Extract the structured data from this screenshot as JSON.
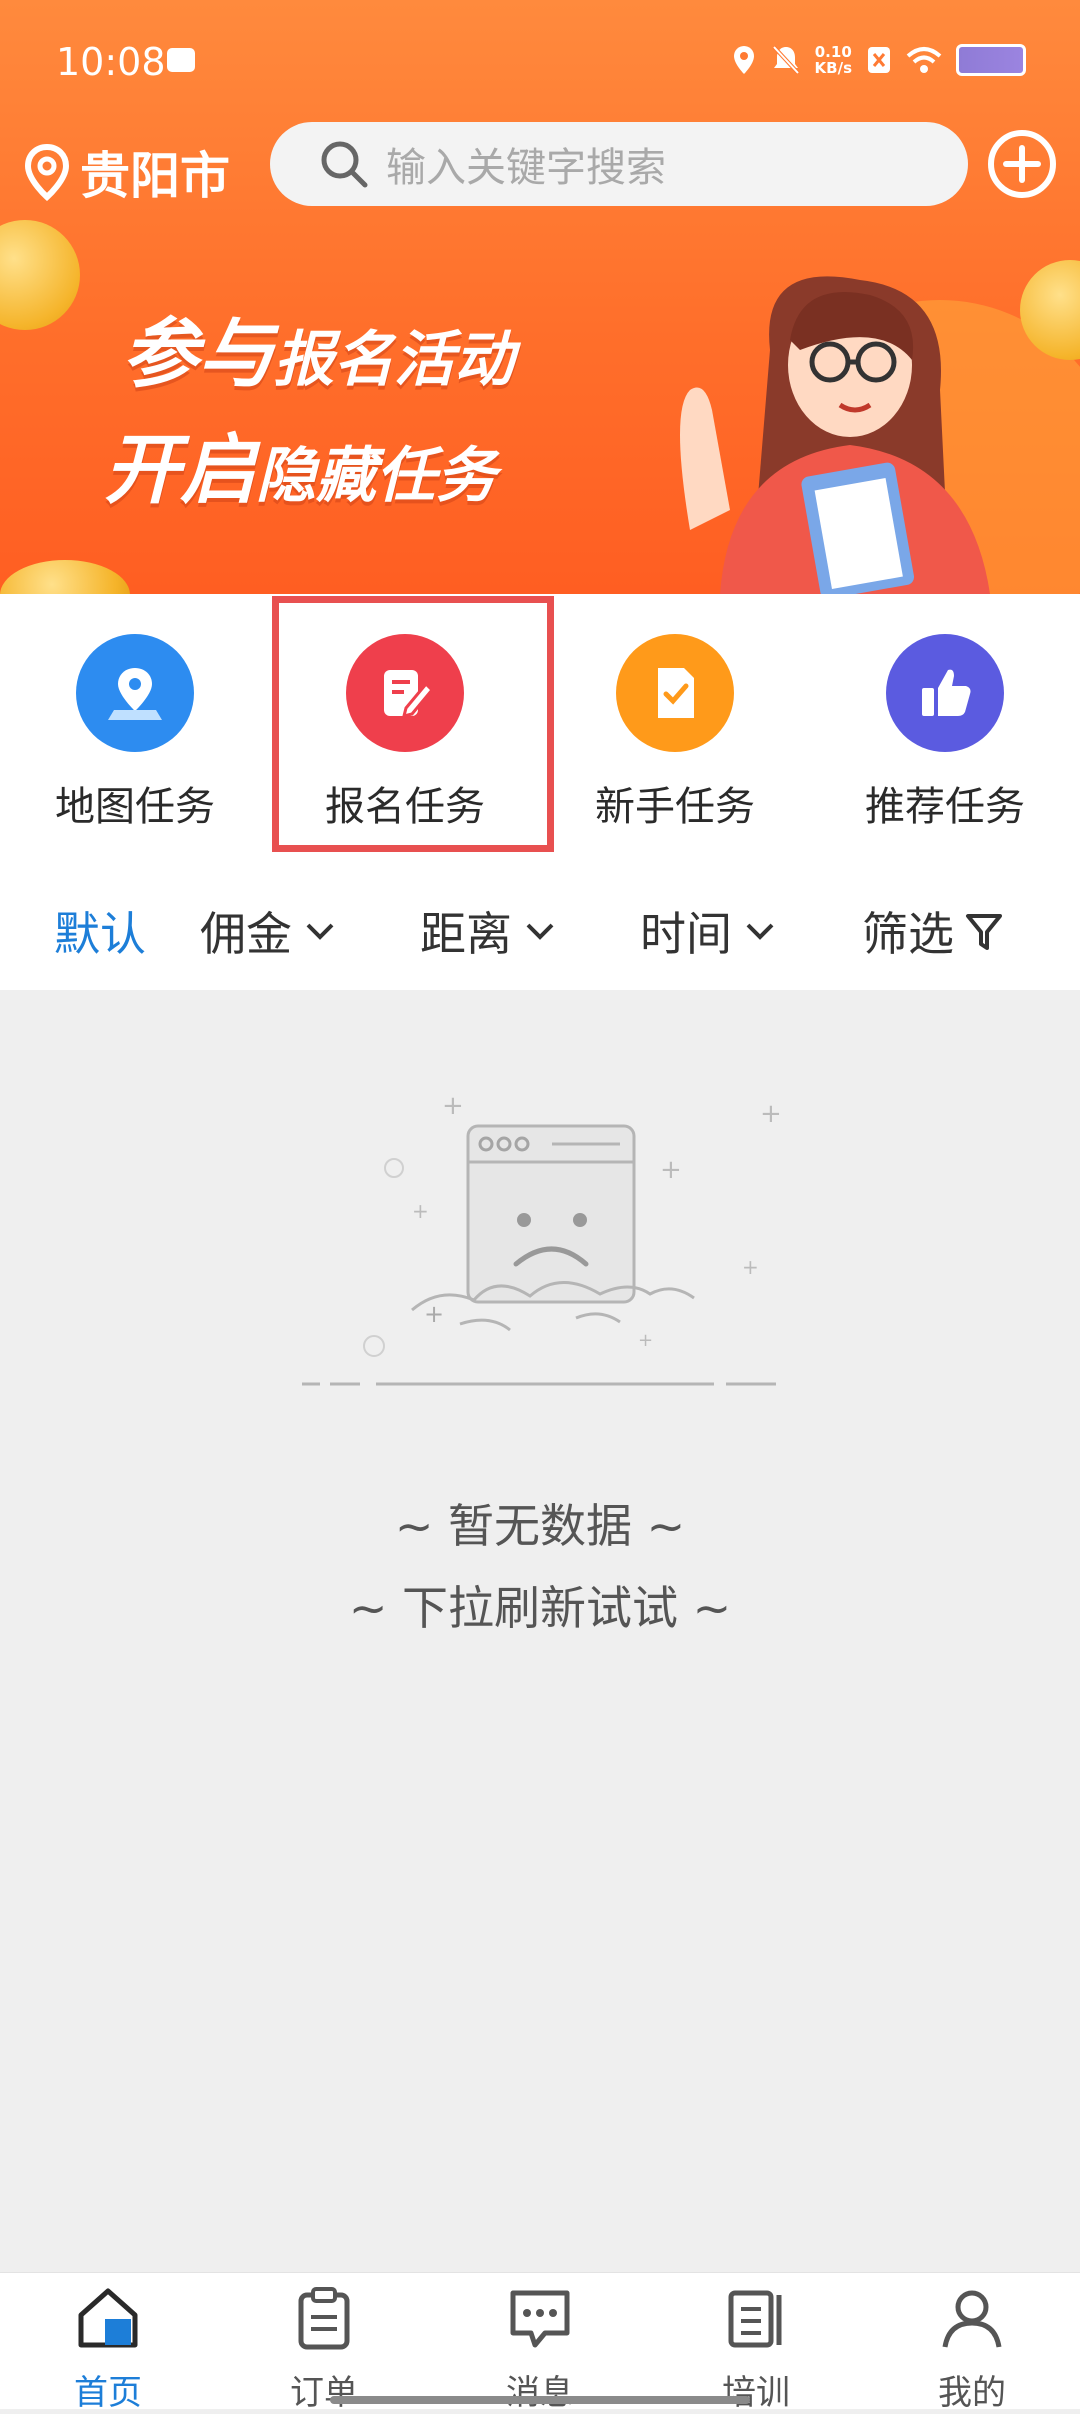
{
  "status_bar": {
    "time": "10:08",
    "speed_value": "0.10",
    "speed_unit": "KB/s"
  },
  "header": {
    "city": "贵阳市",
    "search_placeholder": "输入关键字搜索"
  },
  "banner": {
    "line1_big": "参与",
    "line1_small": "报名活动",
    "line2_big": "开启",
    "line2_small": "隐藏任务"
  },
  "categories": [
    {
      "label": "地图任务",
      "icon": "map-pin-icon",
      "color": "#2d8cf0"
    },
    {
      "label": "报名任务",
      "icon": "edit-form-icon",
      "color": "#ef3f4c"
    },
    {
      "label": "新手任务",
      "icon": "check-document-icon",
      "color": "#ff9a1a"
    },
    {
      "label": "推荐任务",
      "icon": "thumbs-up-icon",
      "color": "#5b5be0"
    }
  ],
  "filters": {
    "default": "默认",
    "commission": "佣金",
    "distance": "距离",
    "time": "时间",
    "screen": "筛选"
  },
  "empty_state": {
    "line1": "~ 暂无数据 ~",
    "line2": "~ 下拉刷新试试 ~"
  },
  "bottom_nav": [
    {
      "label": "首页",
      "icon": "home-icon",
      "active": true
    },
    {
      "label": "订单",
      "icon": "clipboard-icon",
      "active": false
    },
    {
      "label": "消息",
      "icon": "message-icon",
      "active": false
    },
    {
      "label": "培训",
      "icon": "book-icon",
      "active": false
    },
    {
      "label": "我的",
      "icon": "user-icon",
      "active": false
    }
  ],
  "colors": {
    "accent": "#1d7ed8",
    "header_orange": "#ff6f2b",
    "highlight_red": "#e85050"
  }
}
